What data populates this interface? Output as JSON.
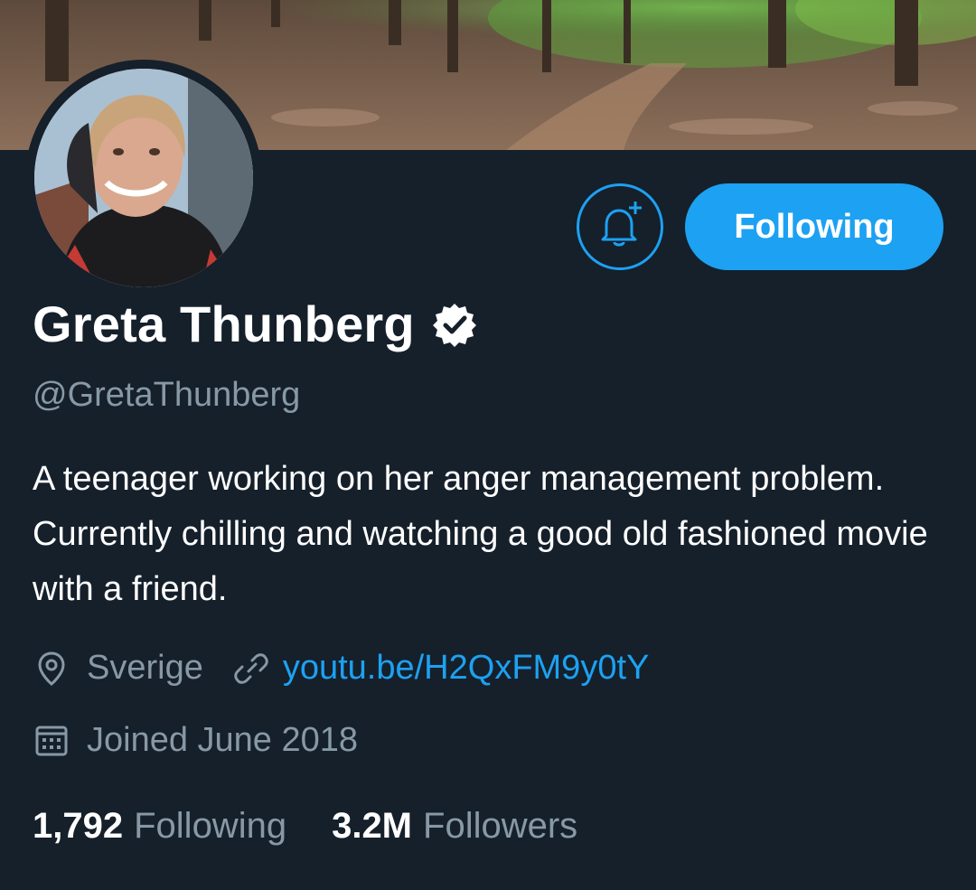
{
  "profile": {
    "display_name": "Greta Thunberg",
    "handle": "@GretaThunberg",
    "verified": true,
    "bio": "A teenager working on her anger management problem. Currently chilling and watching a good old fashioned movie with a friend.",
    "location": "Sverige",
    "url": "youtu.be/H2QxFM9y0tY",
    "joined": "Joined June 2018"
  },
  "actions": {
    "following_label": "Following",
    "notifications_icon": "bell-plus-icon"
  },
  "stats": {
    "following_count": "1,792",
    "following_label": "Following",
    "followers_count": "3.2M",
    "followers_label": "Followers"
  },
  "colors": {
    "background": "#15202b",
    "accent": "#1da1f2",
    "secondary_text": "#8899a6",
    "primary_text": "#ffffff"
  }
}
